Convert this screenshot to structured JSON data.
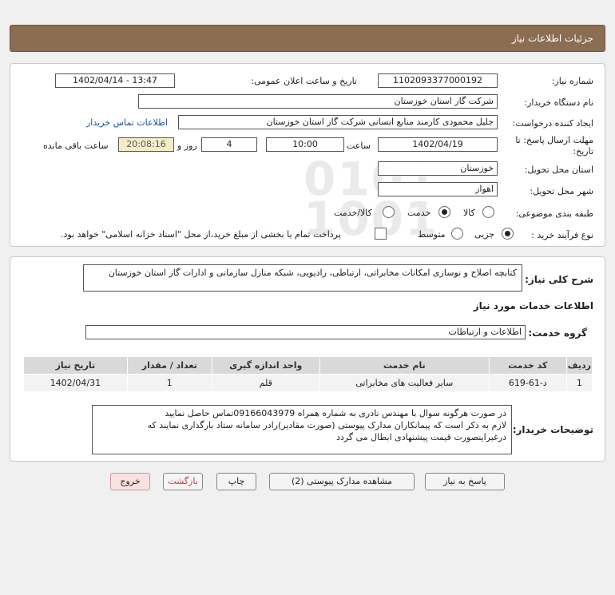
{
  "header": {
    "title": "جزئیات اطلاعات نیاز"
  },
  "form": {
    "need_number_label": "شماره نیاز:",
    "need_number": "1102093377000192",
    "announce_label": "تاریخ و ساعت اعلان عمومی:",
    "announce_value": "1402/04/14 - 13:47",
    "buyer_org_label": "نام دستگاه خریدار:",
    "buyer_org": "شرکت گاز استان خوزستان",
    "requester_label": "ایجاد کننده درخواست:",
    "requester": "جلیل محمودی کارمند منابع انسانی شرکت گاز استان خوزستان",
    "contact_link": "اطلاعات تماس خریدار",
    "deadline_label_1": "مهلت ارسال پاسخ: تا",
    "deadline_label_2": "تاریخ:",
    "deadline_date": "1402/04/19",
    "time_label": "ساعت",
    "deadline_time": "10:00",
    "days_value": "4",
    "days_label": "روز و",
    "remaining_time": "20:08:16",
    "remaining_label": "ساعت باقی مانده",
    "province_label": "استان محل تحویل:",
    "province": "خوزستان",
    "city_label": "شهر محل تحویل:",
    "city": "اهواز",
    "category_label": "طبقه بندی موضوعی:",
    "category_options": [
      "کالا",
      "خدمت",
      "کالا/خدمت"
    ],
    "category_selected": "خدمت",
    "process_label": "نوع فرآیند خرید :",
    "process_options": [
      "جزیی",
      "متوسط"
    ],
    "process_selected": "جزیی",
    "payment_note": "پرداخت تمام یا بخشی از مبلغ خرید،از محل \"اسناد خزانه اسلامی\" خواهد بود."
  },
  "details": {
    "general_desc_label": "شرح کلی نیاز:",
    "general_desc": "کتابچه اصلاح و نوسازی امکانات مخابراتی، ارتباطی، رادیویی، شبکه منازل سازمانی و ادارات گاز استان خوزستان",
    "services_title": "اطلاعات خدمات مورد نیاز",
    "service_group_label": "گروه خدمت:",
    "service_group": "اطلاعات و ارتباطات",
    "table": {
      "headers": [
        "ردیف",
        "کد خدمت",
        "نام خدمت",
        "واحد اندازه گیری",
        "تعداد / مقدار",
        "تاریخ نیاز"
      ],
      "rows": [
        [
          "1",
          "د-61-619",
          "سایر فعالیت های مخابراتی",
          "قلم",
          "1",
          "1402/04/31"
        ]
      ]
    },
    "buyer_notes_label": "توضیحات خریدار:",
    "buyer_notes": [
      "در صورت هرگونه سوال با مهندس نادری به شماره همراه 09166043979تماس حاصل نمایید",
      "لازم به ذکر است که پیمانکاران مدارک پیوستی (صورت مقادیر)رادر سامانه ستاد بارگذاری نمایند که",
      "درغیراینصورت قیمت پیشنهادی ابطال می گردد"
    ]
  },
  "buttons": {
    "reply": "پاسخ به نیاز",
    "view_attachments": "مشاهده مدارک پیوستی (2)",
    "print": "چاپ",
    "back": "بازگشت",
    "exit": "خروج"
  }
}
